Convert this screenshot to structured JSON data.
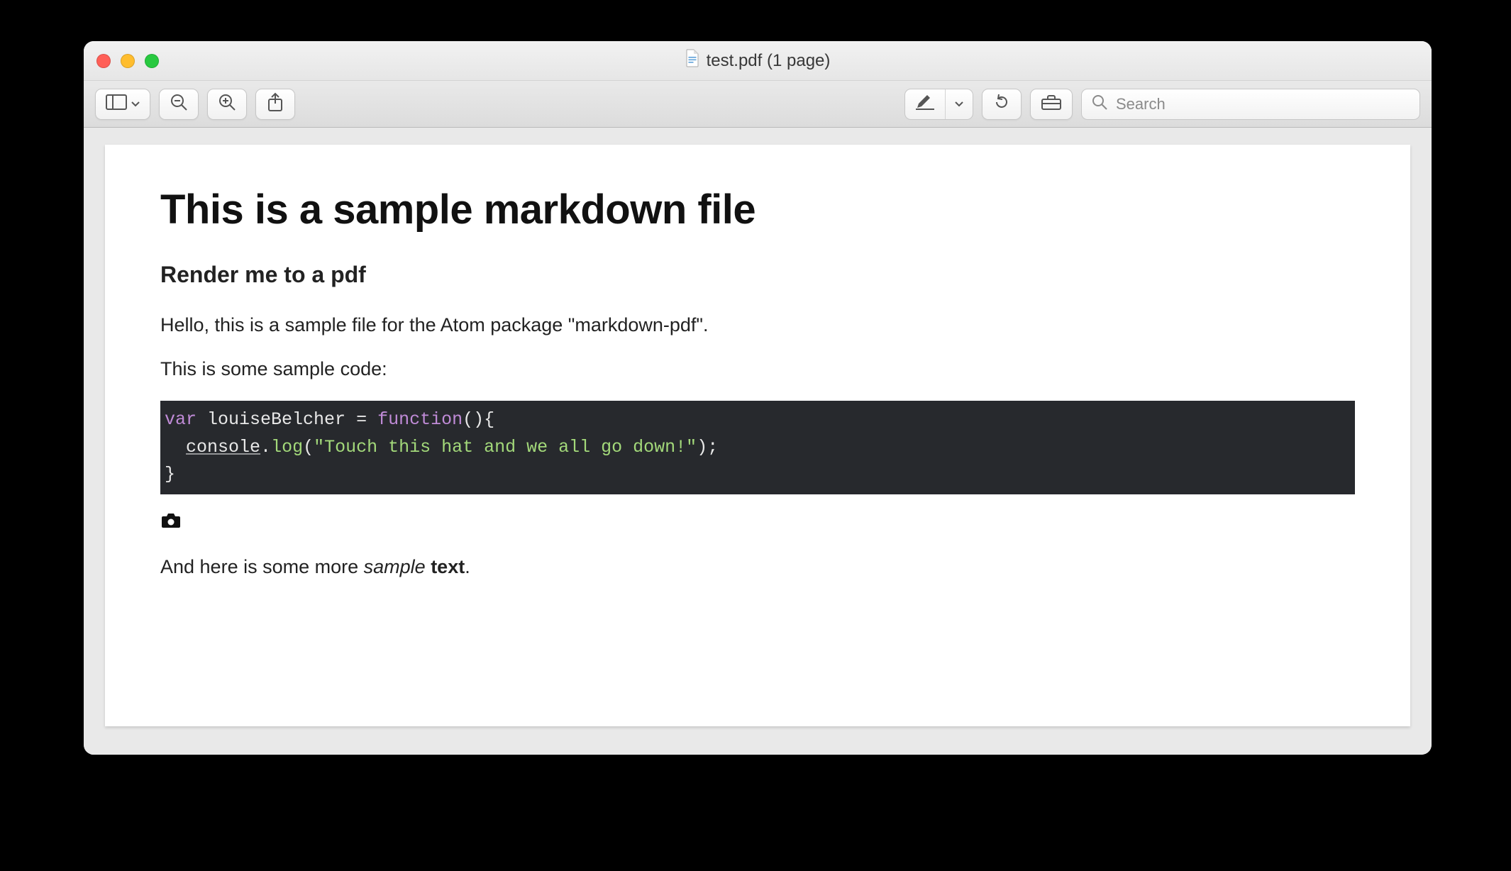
{
  "window": {
    "title": "test.pdf (1 page)"
  },
  "toolbar": {
    "search_placeholder": "Search"
  },
  "icons": {
    "sidebar": "sidebar-icon",
    "zoom_out": "zoom-out-icon",
    "zoom_in": "zoom-in-icon",
    "share": "share-icon",
    "highlight": "highlighter-icon",
    "rotate": "rotate-left-icon",
    "markup_toolbar": "toolbox-icon",
    "search": "search-icon",
    "chevron_down": "chevron-down-icon",
    "image_missing": "camera-icon",
    "document": "document-icon"
  },
  "document": {
    "h1": "This is a sample markdown file",
    "h2": "Render me to a pdf",
    "p1": "Hello, this is a sample file for the Atom package \"markdown-pdf\".",
    "p2": "This is some sample code:",
    "code": {
      "line1": {
        "kw_var": "var",
        "sp1": " ",
        "name": "louiseBelcher",
        "eq": " = ",
        "kw_func": "function",
        "parens_brace": "(){"
      },
      "line2": {
        "indent": "  ",
        "obj": "console",
        "dot": ".",
        "method": "log",
        "open": "(",
        "str": "\"Touch this hat and we all go down!\"",
        "close_semi": ");"
      },
      "line3": {
        "brace": "}"
      }
    },
    "footer_pre": "And here is some more ",
    "footer_em": "sample",
    "footer_sp": " ",
    "footer_strong": "text",
    "footer_end": "."
  }
}
